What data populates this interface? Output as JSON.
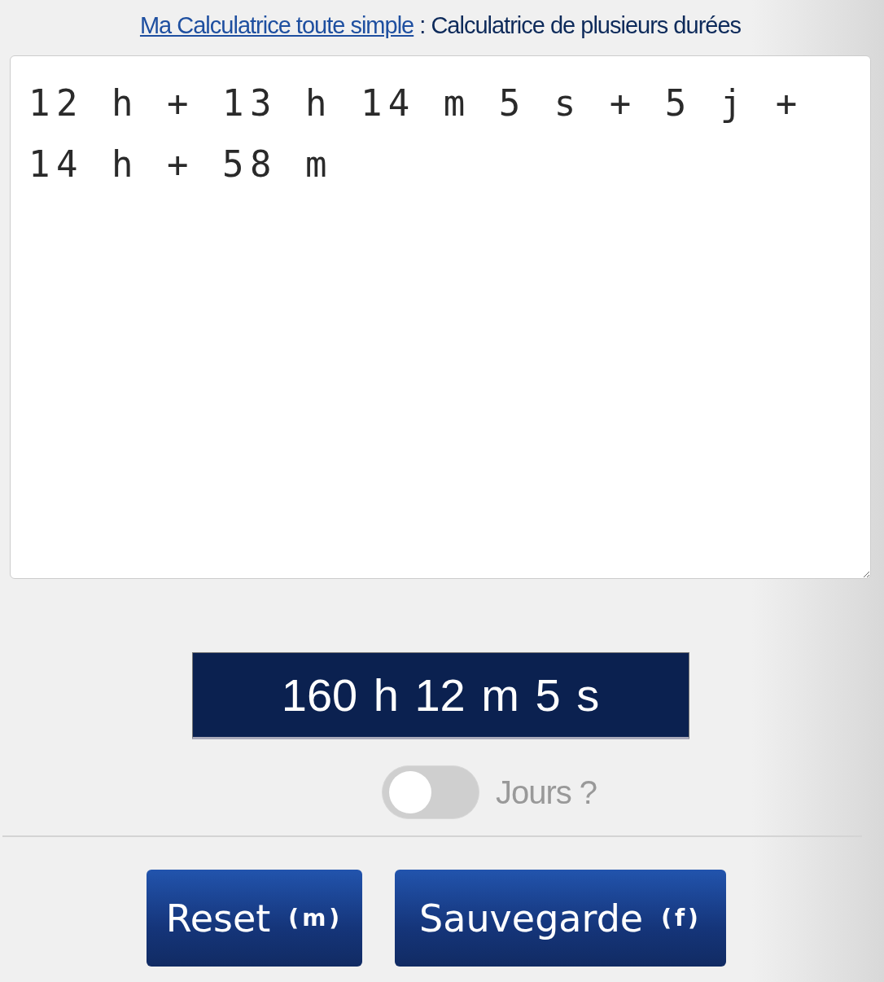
{
  "header": {
    "link": "Ma Calculatrice toute simple",
    "separator": " : ",
    "title": "Calculatrice de plusieurs durées"
  },
  "input": {
    "value": "12 h + 13 h 14 m 5 s + 5 j + 14 h + 58 m"
  },
  "result": "160 h 12 m 5 s",
  "days_toggle": {
    "label": "Jours ?",
    "on": false
  },
  "buttons": [
    {
      "label": "Reset",
      "shortcut": "(m)"
    },
    {
      "label": "Sauvegarde",
      "shortcut": "(f)"
    }
  ]
}
